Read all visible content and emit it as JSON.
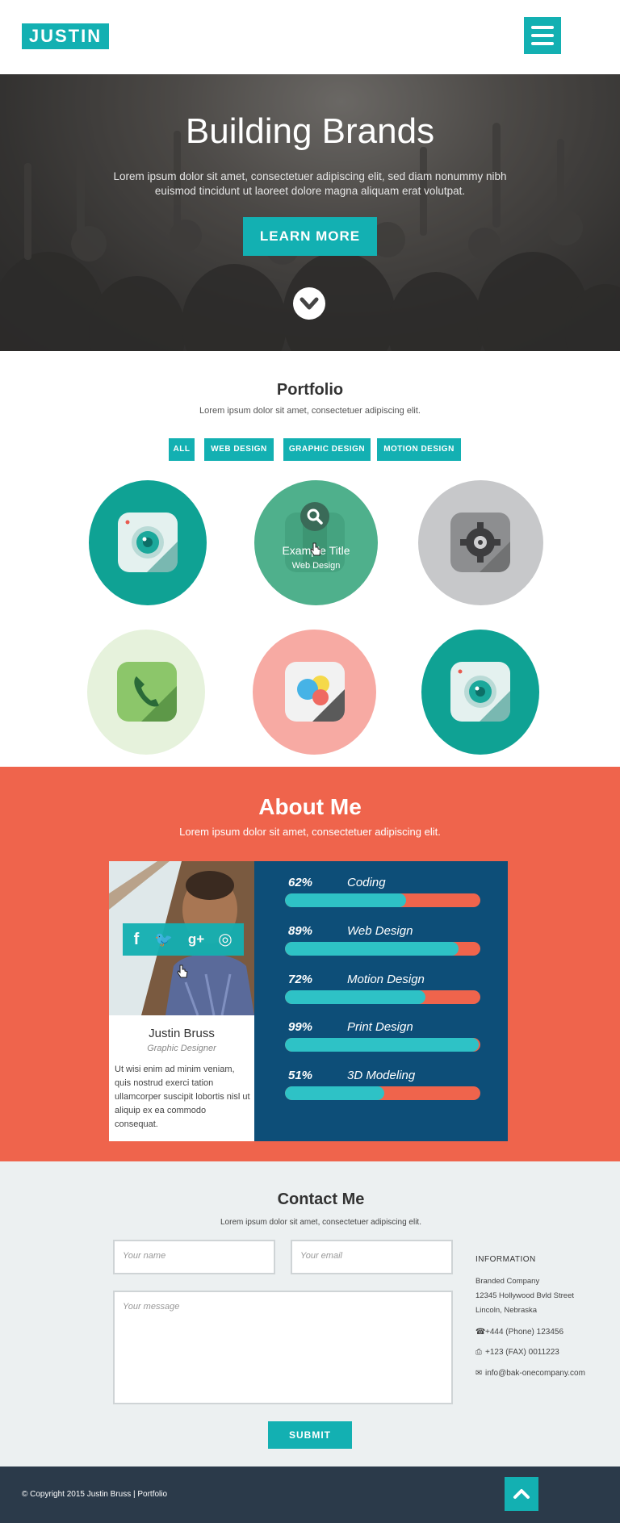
{
  "header": {
    "logo": "JUSTIN",
    "menu_icon": "hamburger-menu-icon"
  },
  "hero": {
    "title": "Building Brands",
    "subtitle": "Lorem ipsum dolor sit amet, consectetuer adipiscing elit, sed diam nonummy nibh euismod tincidunt ut laoreet dolore magna aliquam erat volutpat.",
    "button_label": "LEARN MORE",
    "scroll_icon": "chevron-down-icon"
  },
  "portfolio": {
    "title": "Portfolio",
    "subtitle": "Lorem ipsum dolor sit amet, consectetuer adipiscing elit.",
    "filters": [
      "ALL",
      "WEB DESIGN",
      "GRAPHIC DESIGN",
      "MOTION DESIGN"
    ],
    "items": [
      {
        "icon": "camera-icon",
        "color": "#0fa294"
      },
      {
        "icon": "document-icon",
        "color": "#4fb08c",
        "hover_title": "Example Title",
        "hover_category": "Web Design",
        "overlay_icon": "search-icon"
      },
      {
        "icon": "gear-icon",
        "color": "#c7c8ca"
      },
      {
        "icon": "phone-icon",
        "color": "#e6f2dc"
      },
      {
        "icon": "palette-icon",
        "color": "#f7aaa3"
      },
      {
        "icon": "camera-icon",
        "color": "#0fa294"
      }
    ]
  },
  "about": {
    "title": "About Me",
    "subtitle": "Lorem ipsum dolor sit amet, consectetuer adipiscing elit.",
    "name": "Justin Bruss",
    "role": "Graphic Designer",
    "bio": "Ut wisi enim ad minim veniam, quis nostrud exerci tation ullamcorper suscipit lobortis nisl ut aliquip ex ea commodo consequat.",
    "social": [
      "facebook-icon",
      "twitter-icon",
      "google-plus-icon",
      "dribbble-icon"
    ],
    "skills": [
      {
        "percent": "62%",
        "name": "Coding",
        "value": 0.62
      },
      {
        "percent": "89%",
        "name": "Web Design",
        "value": 0.89
      },
      {
        "percent": "72%",
        "name": "Motion Design",
        "value": 0.72
      },
      {
        "percent": "99%",
        "name": "Print Design",
        "value": 0.99
      },
      {
        "percent": "51%",
        "name": "3D Modeling",
        "value": 0.51
      }
    ]
  },
  "contact": {
    "title": "Contact Me",
    "subtitle": "Lorem ipsum dolor sit amet, consectetuer adipiscing elit.",
    "name_placeholder": "Your name",
    "email_placeholder": "Your email",
    "message_placeholder": "Your message",
    "submit_label": "SUBMIT",
    "info_heading": "INFORMATION",
    "company": "Branded Company",
    "street": "12345 Hollywood Bvld Street",
    "city": "Lincoln, Nebraska",
    "phone": "+444 (Phone) 123456",
    "fax": "+123 (FAX) 0011223",
    "email": "info@bak-onecompany.com"
  },
  "footer": {
    "copyright": "© Copyright 2015 Justin Bruss  |  Portfolio",
    "top_icon": "chevron-up-icon"
  },
  "colors": {
    "accent": "#13b0b2",
    "about_bg": "#ef644c",
    "skills_bg": "#0d4e78",
    "bar_fill": "#2ec2c6",
    "contact_bg": "#ecf0f1",
    "footer_bg": "#2b3a4a"
  }
}
